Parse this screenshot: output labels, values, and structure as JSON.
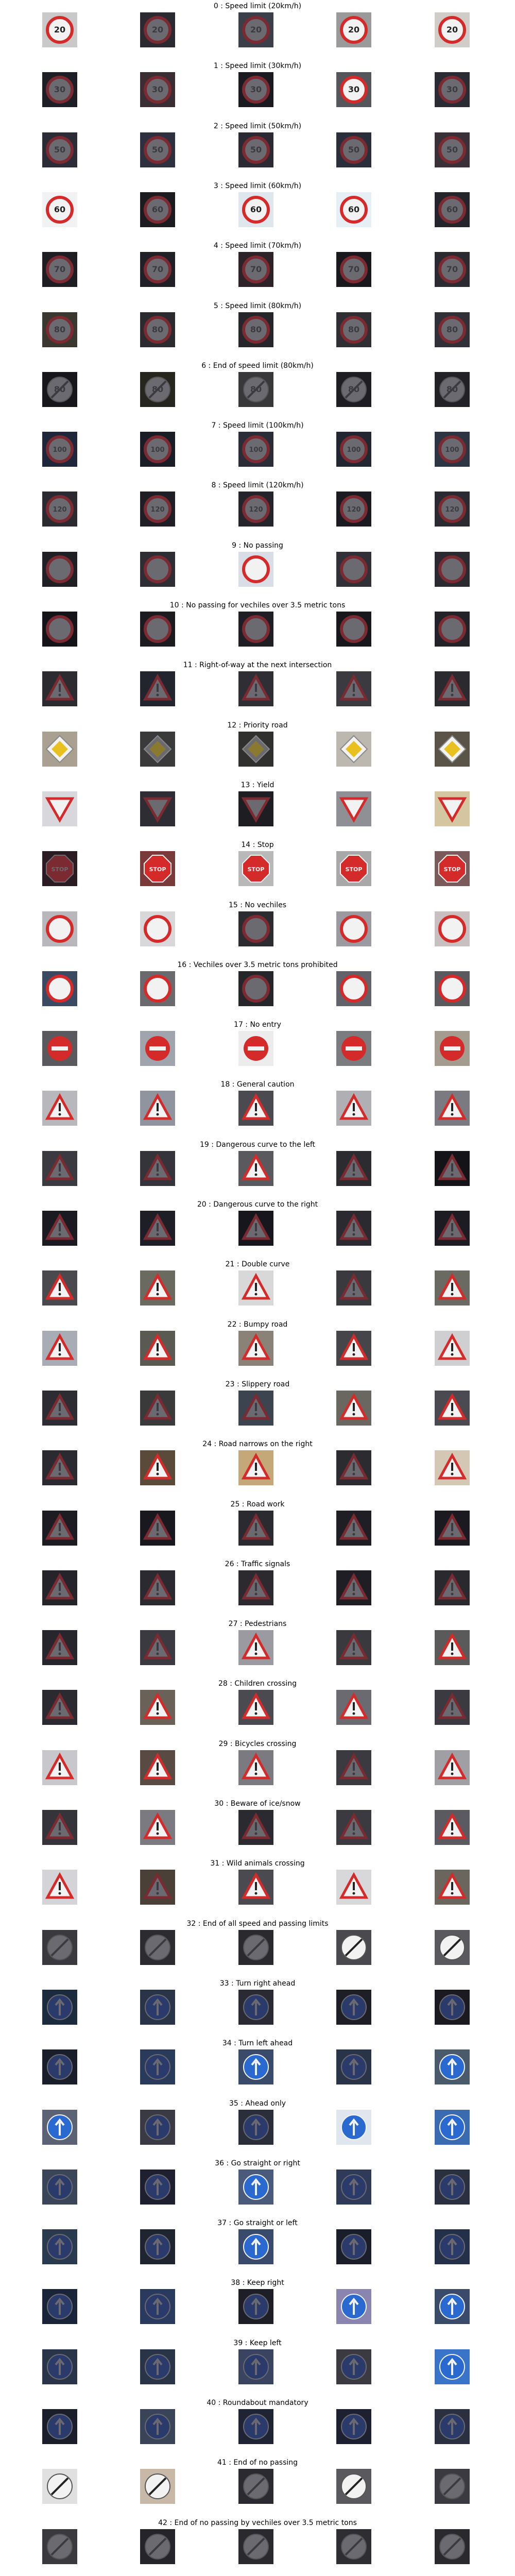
{
  "rows": [
    {
      "title": "0 : Speed limit (20km/h)",
      "icon": "speed-limit-sign-icon",
      "text": "20",
      "thumbs": [
        "#c9c9c9",
        "#2a2a30",
        "#3b3f4a",
        "#9a9a9a",
        "#d0ccc8"
      ]
    },
    {
      "title": "1 : Speed limit (30km/h)",
      "icon": "speed-limit-sign-icon",
      "text": "30",
      "thumbs": [
        "#1e1f26",
        "#3a2d33",
        "#1a1a20",
        "#55555c",
        "#2b2b33"
      ]
    },
    {
      "title": "2 : Speed limit (50km/h)",
      "icon": "speed-limit-sign-icon",
      "text": "50",
      "thumbs": [
        "#2b2c36",
        "#2e3040",
        "#2b2a33",
        "#2a2e3a",
        "#3a3038"
      ]
    },
    {
      "title": "3 : Speed limit (60km/h)",
      "icon": "speed-limit-sign-icon",
      "text": "60",
      "thumbs": [
        "#f1f2f4",
        "#1b1b20",
        "#dfe6ee",
        "#e6eef6",
        "#24242b"
      ]
    },
    {
      "title": "4 : Speed limit (70km/h)",
      "icon": "speed-limit-sign-icon",
      "text": "70",
      "thumbs": [
        "#1d1d22",
        "#202026",
        "#2c2228",
        "#18181d",
        "#2a2a30"
      ]
    },
    {
      "title": "5 : Speed limit (80km/h)",
      "icon": "speed-limit-sign-icon",
      "text": "80",
      "thumbs": [
        "#3a3630",
        "#2b2b2f",
        "#25252a",
        "#2e2e33",
        "#313036"
      ]
    },
    {
      "title": "6 : End of speed limit (80km/h)",
      "icon": "end-speed-limit-sign-icon",
      "text": "80",
      "thumbs": [
        "#17171b",
        "#26261e",
        "#38383a",
        "#1d1d22",
        "#222226"
      ]
    },
    {
      "title": "7 : Speed limit (100km/h)",
      "icon": "speed-limit-sign-icon",
      "text": "100",
      "thumbs": [
        "#20263a",
        "#1b1d26",
        "#2a2d38",
        "#222630",
        "#2d3442"
      ]
    },
    {
      "title": "8 : Speed limit (120km/h)",
      "icon": "speed-limit-sign-icon",
      "text": "120",
      "thumbs": [
        "#2a2a30",
        "#1e1e24",
        "#24242a",
        "#1a1a20",
        "#2a2a30"
      ]
    },
    {
      "title": "9 : No passing",
      "icon": "no-passing-sign-icon",
      "text": "",
      "thumbs": [
        "#1f1f24",
        "#2d2d33",
        "#d9dde6",
        "#303036",
        "#2a2a30"
      ]
    },
    {
      "title": "10 : No passing for vechiles over 3.5 metric tons",
      "icon": "no-passing-trucks-sign-icon",
      "text": "",
      "thumbs": [
        "#141418",
        "#1b1b20",
        "#1e1e24",
        "#18181c",
        "#222228"
      ]
    },
    {
      "title": "11 : Right-of-way at the next intersection",
      "icon": "warning-triangle-icon",
      "text": "",
      "thumbs": [
        "#2b2b30",
        "#22252e",
        "#2e2e34",
        "#3a3a40",
        "#2a2a2f"
      ]
    },
    {
      "title": "12 : Priority road",
      "icon": "priority-road-sign-icon",
      "text": "",
      "thumbs": [
        "#a9a092",
        "#3a3a3a",
        "#30302e",
        "#bcb8b0",
        "#5a5448"
      ]
    },
    {
      "title": "13 : Yield",
      "icon": "yield-sign-icon",
      "text": "",
      "thumbs": [
        "#d8d8dc",
        "#2d2d33",
        "#1d1d22",
        "#8f8f96",
        "#d4c6a0"
      ]
    },
    {
      "title": "14 : Stop",
      "icon": "stop-sign-icon",
      "text": "STOP",
      "thumbs": [
        "#2a1c22",
        "#7a3a3a",
        "#b8b8b8",
        "#a8a8a8",
        "#7a5a5a"
      ]
    },
    {
      "title": "15 : No vechiles",
      "icon": "no-vehicles-sign-icon",
      "text": "",
      "thumbs": [
        "#b8b8bc",
        "#d8d8da",
        "#2c2c30",
        "#9a9aa0",
        "#c8c0c0"
      ]
    },
    {
      "title": "16 : Vechiles over 3.5 metric tons prohibited",
      "icon": "no-trucks-sign-icon",
      "text": "",
      "thumbs": [
        "#3a4a62",
        "#6a6a6e",
        "#26262a",
        "#62626a",
        "#5a5a5e"
      ]
    },
    {
      "title": "17 : No entry",
      "icon": "no-entry-sign-icon",
      "text": "",
      "thumbs": [
        "#5a5a5e",
        "#a0a4ac",
        "#ececec",
        "#7a7c80",
        "#a49c8e"
      ]
    },
    {
      "title": "18 : General caution",
      "icon": "warning-triangle-icon",
      "text": "",
      "thumbs": [
        "#b8b8bc",
        "#8f949e",
        "#4a4a50",
        "#b0b0b4",
        "#7a7a80"
      ]
    },
    {
      "title": "19 : Dangerous curve to the left",
      "icon": "warning-triangle-icon",
      "text": "",
      "thumbs": [
        "#3a3a40",
        "#34343a",
        "#5a5a5e",
        "#2c2c30",
        "#141418"
      ]
    },
    {
      "title": "20 : Dangerous curve to the right",
      "icon": "warning-triangle-icon",
      "text": "",
      "thumbs": [
        "#1a1a20",
        "#1e1e26",
        "#16161c",
        "#2a2a30",
        "#1c1c22"
      ]
    },
    {
      "title": "21 : Double curve",
      "icon": "warning-triangle-icon",
      "text": "",
      "thumbs": [
        "#4a4a4e",
        "#6a6a60",
        "#d8d8d8",
        "#3a3a3e",
        "#6a6a62"
      ]
    },
    {
      "title": "22 : Bumpy road",
      "icon": "warning-triangle-icon",
      "text": "",
      "thumbs": [
        "#a8acb4",
        "#5a5a52",
        "#8a8276",
        "#46464a",
        "#cfcfd2"
      ]
    },
    {
      "title": "23 : Slippery road",
      "icon": "warning-triangle-icon",
      "text": "",
      "thumbs": [
        "#2c2c32",
        "#3a3a3a",
        "#3c4450",
        "#6a6660",
        "#4a4a50"
      ]
    },
    {
      "title": "24 : Road narrows on the right",
      "icon": "warning-triangle-icon",
      "text": "",
      "thumbs": [
        "#2a2a30",
        "#5a4a3a",
        "#c4a878",
        "#2c2c30",
        "#d4c8b4"
      ]
    },
    {
      "title": "25 : Road work",
      "icon": "warning-triangle-icon",
      "text": "",
      "thumbs": [
        "#1c1c22",
        "#18181e",
        "#2a2a30",
        "#1e1e24",
        "#1a1a20"
      ]
    },
    {
      "title": "26 : Traffic signals",
      "icon": "warning-triangle-icon",
      "text": "",
      "thumbs": [
        "#24242a",
        "#2a2a30",
        "#2c2a2e",
        "#1e1e24",
        "#2a2a2e"
      ]
    },
    {
      "title": "27 : Pedestrians",
      "icon": "warning-triangle-icon",
      "text": "",
      "thumbs": [
        "#26262c",
        "#3a3a40",
        "#9a9aa0",
        "#3a3a3e",
        "#5a5a5a"
      ]
    },
    {
      "title": "28 : Children crossing",
      "icon": "warning-triangle-icon",
      "text": "",
      "thumbs": [
        "#2a2a30",
        "#6a6258",
        "#4a4a50",
        "#6a6a70",
        "#3a3a40"
      ]
    },
    {
      "title": "29 : Bicycles crossing",
      "icon": "warning-triangle-icon",
      "text": "",
      "thumbs": [
        "#c8c8cc",
        "#5a4a44",
        "#7a7a80",
        "#3a3a40",
        "#a0a0a4"
      ]
    },
    {
      "title": "30 : Beware of ice/snow",
      "icon": "warning-triangle-icon",
      "text": "",
      "thumbs": [
        "#34343a",
        "#7a7a80",
        "#2a2a30",
        "#3a3a40",
        "#5a5a60"
      ]
    },
    {
      "title": "31 : Wild animals crossing",
      "icon": "warning-triangle-icon",
      "text": "",
      "thumbs": [
        "#d4d4d8",
        "#4a4038",
        "#4a4a50",
        "#d8d8da",
        "#6a665e"
      ]
    },
    {
      "title": "32 : End of all speed and passing limits",
      "icon": "end-limits-sign-icon",
      "text": "",
      "thumbs": [
        "#3a3a3e",
        "#2c2c30",
        "#2a2a2e",
        "#4a4a4e",
        "#5a5a5e"
      ]
    },
    {
      "title": "33 : Turn right ahead",
      "icon": "blue-arrow-sign-icon",
      "text": "",
      "thumbs": [
        "#1c2a3e",
        "#2a3448",
        "#2a2a34",
        "#1e1e26",
        "#1a1a20"
      ]
    },
    {
      "title": "34 : Turn left ahead",
      "icon": "blue-arrow-sign-icon",
      "text": "",
      "thumbs": [
        "#1a1e2a",
        "#2a3a5a",
        "#3a4a6a",
        "#2a3448",
        "#4a5a6a"
      ]
    },
    {
      "title": "35 : Ahead only",
      "icon": "blue-arrow-sign-icon",
      "text": "",
      "thumbs": [
        "#5a6274",
        "#3a3a44",
        "#2a2e3a",
        "#e0e6ee",
        "#3a6ab0"
      ]
    },
    {
      "title": "36 : Go straight or right",
      "icon": "blue-arrow-sign-icon",
      "text": "",
      "thumbs": [
        "#3a4658",
        "#1e2030",
        "#4a5a7a",
        "#2e3a58",
        "#2a3040"
      ]
    },
    {
      "title": "37 : Go straight or left",
      "icon": "blue-arrow-sign-icon",
      "text": "",
      "thumbs": [
        "#2a3a4e",
        "#1e2430",
        "#3a4a6a",
        "#1a1e2a",
        "#24304a"
      ]
    },
    {
      "title": "38 : Keep right",
      "icon": "blue-arrow-sign-icon",
      "text": "",
      "thumbs": [
        "#1a2438",
        "#2a3a5e",
        "#1e1e26",
        "#8a84b0",
        "#3a4a6a"
      ]
    },
    {
      "title": "39 : Keep left",
      "icon": "blue-arrow-sign-icon",
      "text": "",
      "thumbs": [
        "#2a3448",
        "#2a3448",
        "#3a4460",
        "#3a3a40",
        "#3a74c8"
      ]
    },
    {
      "title": "40 : Roundabout mandatory",
      "icon": "roundabout-sign-icon",
      "text": "",
      "thumbs": [
        "#1a1e2a",
        "#3a4458",
        "#1e2434",
        "#1c2030",
        "#2a3040"
      ]
    },
    {
      "title": "41 : End of no passing",
      "icon": "end-no-passing-sign-icon",
      "text": "",
      "thumbs": [
        "#e0e0e0",
        "#c8b8a8",
        "#2a2a30",
        "#5a5a5e",
        "#3a3a40"
      ]
    },
    {
      "title": "42 : End of no passing by vechiles over 3.5 metric tons",
      "icon": "end-no-passing-trucks-sign-icon",
      "text": "",
      "thumbs": [
        "#3a3a3e",
        "#24242a",
        "#2a2a2e",
        "#2e2e32",
        "#2a2a2e"
      ]
    }
  ]
}
